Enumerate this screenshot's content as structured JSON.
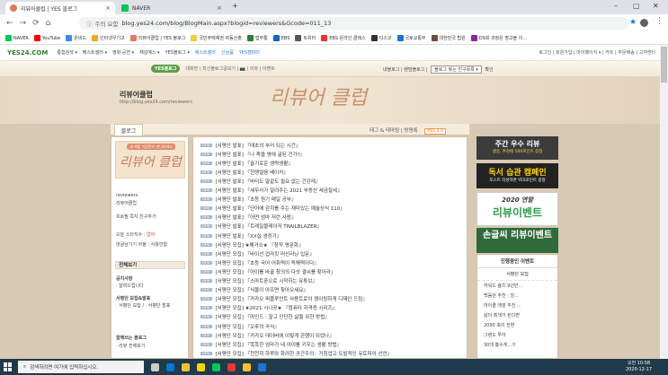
{
  "browser": {
    "tabs": [
      {
        "label": "리뷰어클럽 | YES 블로그",
        "icon_color": "#e07a5f",
        "active": true
      },
      {
        "label": "NAVER",
        "icon_color": "#03c75a",
        "active": false
      }
    ],
    "new_tab": "+",
    "address": {
      "security": "주의 요함",
      "url": "blog.yes24.com/blog/BlogMain.aspx?blogid=reviewers&Gcode=011_13"
    },
    "bookmarks": [
      {
        "label": "NAVER",
        "color": "#03c75a"
      },
      {
        "label": "YouTube",
        "color": "#ff0000"
      },
      {
        "label": "온비드",
        "color": "#4285f4"
      },
      {
        "label": "인터넷우기고",
        "color": "#f5a623"
      },
      {
        "label": "리뷰어클럽 | YES 블로그",
        "color": "#e07a5f"
      },
      {
        "label": "국민주택채권 자동산출",
        "color": "#f7c843"
      },
      {
        "label": "법무통",
        "color": "#2e7d32"
      },
      {
        "label": "EBS",
        "color": "#1565c0"
      },
      {
        "label": "트위터",
        "color": "#555555"
      },
      {
        "label": "EBS 온라인 클래스",
        "color": "#e53935"
      },
      {
        "label": "디스코",
        "color": "#333333"
      },
      {
        "label": "국토교통부",
        "color": "#1976d2"
      },
      {
        "label": "대한민국 법원",
        "color": "#6d4c41"
      },
      {
        "label": "DS회 과정은 명고볼 이...",
        "color": "#8e24aa"
      }
    ]
  },
  "site_nav": {
    "logo": "YES24.COM",
    "items": [
      "통합검색 ▾",
      "베스트셀러 ▾",
      "영화·공연 ▾",
      "채널예스 ▾",
      "YES블로그 ▾",
      "베스트셀러",
      "신상품",
      "YES캠퍼터"
    ],
    "right": "로그인 | 회원가입 | 마이페이지 ▾ | 카트 | 주문배송 | 고객센터"
  },
  "blog_bar": {
    "badge": "YES블로그",
    "links": "대화방 | 최신블로그글보기 | 📷 | 리뷰 | 이벤트",
    "right_prefix": "내블로그 | 랜덤블로그 |",
    "select": "블로그 찾는 친구목록 ▾",
    "right_suffix": "확인"
  },
  "hero": {
    "title": "리뷰어클럽",
    "url": "http://blog.yes24.com/reviewers",
    "script": "리뷰어 클럽"
  },
  "stripe": {
    "tab": "블로그",
    "links": "태그 & 테마링  |  방명록",
    "rss": "RSS 2.0"
  },
  "sidebar": {
    "top_label": "새 책을 가장먼저 만나보세요",
    "script": "리뷰어 클럽",
    "id": "reviewers",
    "name": "리뷰어클럽",
    "actions": "프로필  쪽지  친구추가",
    "stat1": "오늘 스타지수 : ",
    "stat1_value": "없어",
    "stat2": "댓글남기기 비율 : 사용안함",
    "cat_header": "전체보기",
    "groups": [
      {
        "title": "공지사항",
        "sub": "· 알려드립니다"
      },
      {
        "title": "서평단 모집&발표",
        "sub": "· 서평단 모집 / · 서평단 발표"
      }
    ],
    "together_header": "함께쓰는 블로그",
    "together_item": "· 리뷰 전체보기"
  },
  "posts": [
    "[서평단 발표] 『태초의 부러 되는 시간』",
    "[서평단 발표] 『나 죽을 명애 굴된 건가?』",
    "[서평단 발표] 『술기로운 생략생활』",
    "[서평단 발표] 『천쟁얼음 베이커』",
    "[서평단 발표] 『바터도 말같도 필요 없는 건강레』",
    "[서평단 발표] 『세무사가 알려주는 2021 부동산 세금절세』",
    "[서평단 발표] 『초등 원기 매일 공부』",
    "[서평단 발표] 『단어에 갇히를 주는 재미있는 예술상식 110』",
    "[서평단 발표] 『어떤 엄마 저런 사람』",
    "[서평단 발표] 『트레일블레이저 TRAILBLAZER』",
    "[서평단 발표] 『XX실 생정기』",
    "[서평단 모집] ★해거소★ 『창작 명문화』",
    "[서평단 모집] 『바이선 업라킷 머신러닝 입문』",
    "[서평단 모집] 『초등 국어 어휘력이 독해력이다』",
    "[서평단 모집] 『아이를 바꿀 창의의 다섯 결씨를 찾아라』",
    "[서평단 모집] 『스마트폰으로 시작하는 유튜브』",
    "[서평단 모집] 『식물이 아프면 찾아오세요』",
    "[서평단 모집] 『카카오 퍼플루언트 사용트로이 캠이링하게 디재인 드림』",
    "[서평단 모집] ★2021 시나공★ 『컴퓨터 자격증 시리즈』",
    "[서평단 모집] 『마인드 : 잘고 단단한 삶을 위한 방법』",
    "[서평단 모집] 『오후의 곡식』",
    "[서평단 모집] 『카카오 데이버에 이렇게 관행이 되었나』",
    "[서평단 모집] 『똑똑한 엄마가 내 아이를 키우는 생활 방법』",
    "[서평단 모집] 『천천히 하루와 화려한 공간주의 : 거침업고 도발적인 유토피아 선언』"
  ],
  "post_badge": "NEW",
  "right": {
    "b1_title": "주간 우수 리뷰",
    "b1_sub": "댓글, 추천에 500포인트 증정",
    "b2_title": "독서 습관 캠페인",
    "b2_sub": "포스트 작성하면 YES포인트 증정",
    "b3_year": "2020 연말",
    "b3_title": "리뷰이벤트",
    "b4_title": "손글씨 리뷰이벤트",
    "box_header": "진행중인 이벤트",
    "box_sub": "서평단 모집",
    "events": [
      "하워드 슐츠 9년만...",
      "백움원 추천 : 앙...",
      "마이클 레빌 추천 ...",
      "삶이 흑색가 된다면",
      "2090 축의 전환",
      "그랜드 투어",
      "30대 흉수게...기"
    ]
  },
  "taskbar": {
    "search": "검색하려면 여기에 입력하십시오.",
    "time": "오전 10:58",
    "date": "2020-12-17"
  }
}
